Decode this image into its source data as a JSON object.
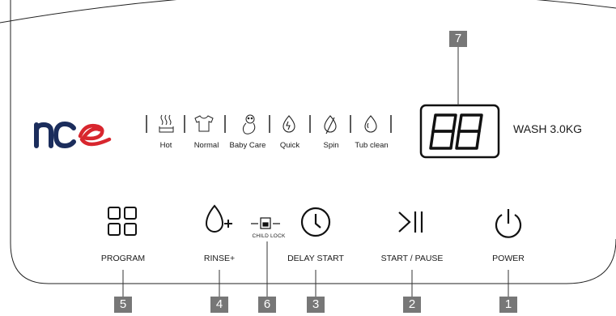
{
  "brand": {
    "name": "nce"
  },
  "display": {
    "digits": "88",
    "capacity_label": "WASH 3.0KG"
  },
  "programs": [
    {
      "label": "Hot",
      "icon": "hot-water-icon"
    },
    {
      "label": "Normal",
      "icon": "shirt-icon"
    },
    {
      "label": "Baby Care",
      "icon": "baby-icon"
    },
    {
      "label": "Quick",
      "icon": "quick-drop-icon"
    },
    {
      "label": "Spin",
      "icon": "spin-drop-icon"
    },
    {
      "label": "Tub clean",
      "icon": "tub-clean-drop-icon"
    }
  ],
  "buttons": {
    "program": {
      "label": "PROGRAM",
      "icon": "grid-icon",
      "number": "5"
    },
    "rinse": {
      "label": "RINSE+",
      "icon": "drop-plus-icon",
      "number": "4"
    },
    "child_lock": {
      "label": "CHILD LOCK",
      "icon": "lock-icon",
      "number": "6"
    },
    "delay_start": {
      "label": "DELAY START",
      "icon": "clock-icon",
      "number": "3"
    },
    "start_pause": {
      "label": "START / PAUSE",
      "icon": "play-pause-icon",
      "number": "2"
    },
    "power": {
      "label": "POWER",
      "icon": "power-icon",
      "number": "1"
    }
  },
  "display_number": "7",
  "colors": {
    "brand_red": "#d8262e",
    "brand_navy": "#1b2d5c",
    "tag_gray": "#777777"
  }
}
